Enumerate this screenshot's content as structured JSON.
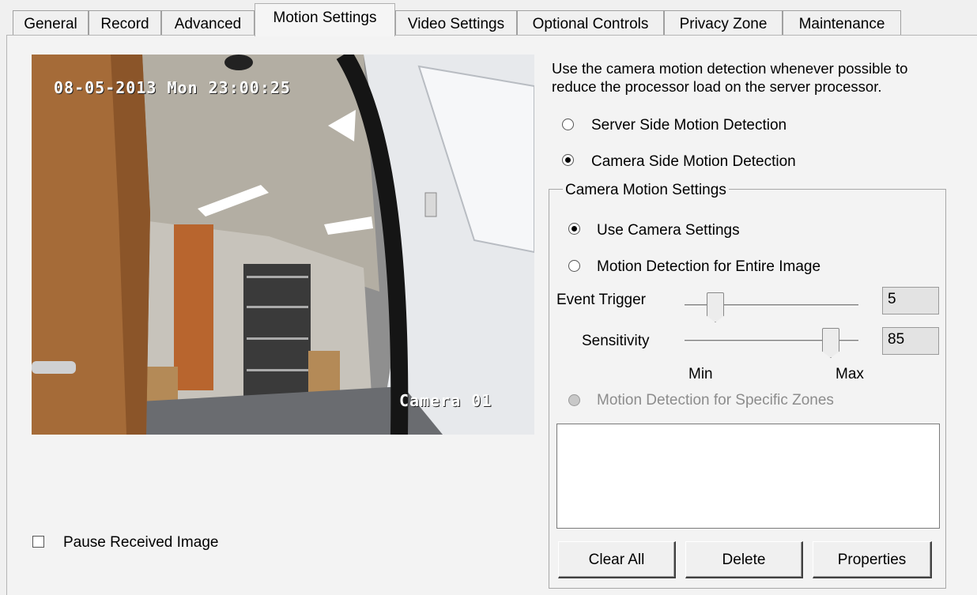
{
  "tabs": [
    {
      "label": "General",
      "active": false
    },
    {
      "label": "Record",
      "active": false
    },
    {
      "label": "Advanced",
      "active": false
    },
    {
      "label": "Motion Settings",
      "active": true
    },
    {
      "label": "Video Settings",
      "active": false
    },
    {
      "label": "Optional Controls",
      "active": false
    },
    {
      "label": "Privacy Zone",
      "active": false
    },
    {
      "label": "Maintenance",
      "active": false
    }
  ],
  "camera": {
    "timestamp": "08-05-2013 Mon 23:00:25",
    "camera_label": "Camera 01"
  },
  "pause_label": "Pause Received Image",
  "pause_checked": false,
  "hint_line1": "Use the camera motion detection whenever possible to",
  "hint_line2": "reduce the processor load on the server processor.",
  "server_side_label": "Server Side Motion Detection",
  "server_side_checked": false,
  "camera_side_label": "Camera Side Motion Detection",
  "camera_side_checked": true,
  "group_title": "Camera Motion Settings",
  "use_camera_label": "Use Camera Settings",
  "use_camera_checked": true,
  "entire_image_label": "Motion Detection for Entire Image",
  "entire_image_checked": false,
  "event_trigger": {
    "label": "Event Trigger",
    "value": "5"
  },
  "sensitivity": {
    "label": "Sensitivity",
    "value": "85"
  },
  "slider_min_label": "Min",
  "slider_max_label": "Max",
  "specific_zones_label": "Motion Detection for Specific Zones",
  "specific_zones_enabled": false,
  "buttons": {
    "clear_all": "Clear All",
    "delete": "Delete",
    "properties": "Properties"
  }
}
